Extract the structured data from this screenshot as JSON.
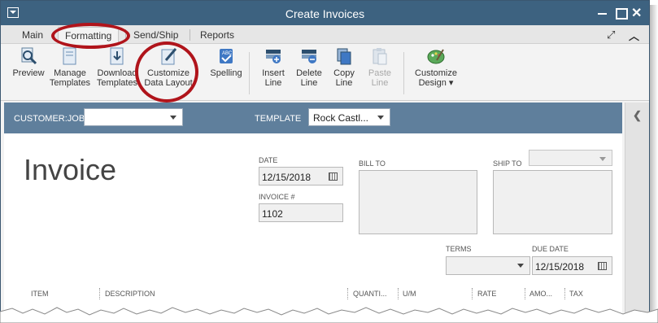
{
  "window": {
    "title": "Create Invoices"
  },
  "tabs": [
    {
      "label": "Main"
    },
    {
      "label": "Formatting"
    },
    {
      "label": "Send/Ship"
    },
    {
      "label": "Reports"
    }
  ],
  "ribbon": {
    "preview": "Preview",
    "manage_templates": [
      "Manage",
      "Templates"
    ],
    "download_templates": [
      "Download",
      "Templates"
    ],
    "customize_layout": [
      "Customize",
      "Data Layout"
    ],
    "spelling": "Spelling",
    "insert_line": [
      "Insert",
      "Line"
    ],
    "delete_line": [
      "Delete",
      "Line"
    ],
    "copy_line": [
      "Copy",
      "Line"
    ],
    "paste_line": [
      "Paste",
      "Line"
    ],
    "customize_design": [
      "Customize",
      "Design ▾"
    ]
  },
  "customer_bar": {
    "customer_job_label": "CUSTOMER:JOB",
    "customer_job_value": "",
    "template_label": "TEMPLATE",
    "template_value": "Rock Castl..."
  },
  "invoice": {
    "title": "Invoice",
    "date_label": "DATE",
    "date_value": "12/15/2018",
    "invoice_no_label": "INVOICE #",
    "invoice_no_value": "1102",
    "bill_to_label": "BILL TO",
    "ship_to_label": "SHIP TO",
    "ship_to_value": "",
    "terms_label": "TERMS",
    "terms_value": "",
    "due_date_label": "DUE DATE",
    "due_date_value": "12/15/2018"
  },
  "columns": [
    "ITEM",
    "DESCRIPTION",
    "QUANTI...",
    "U/M",
    "RATE",
    "AMO...",
    "TAX"
  ],
  "colors": {
    "titlebar": "#3d6280",
    "customer_bar": "#5f7f9c",
    "highlight": "#b0141b"
  }
}
